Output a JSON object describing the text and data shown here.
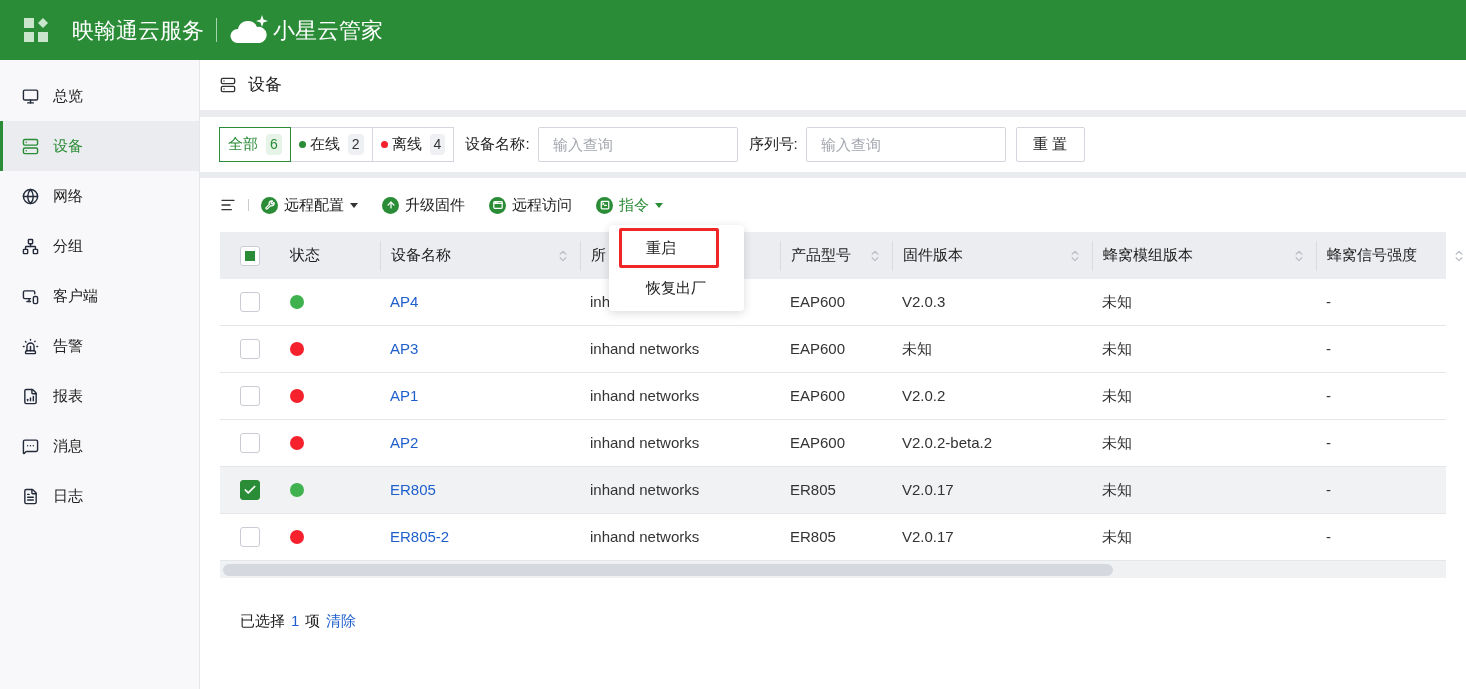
{
  "header": {
    "brand": "映翰通云服务",
    "product": "小星云管家"
  },
  "sidebar": {
    "items": [
      {
        "label": "总览",
        "selected": false
      },
      {
        "label": "设备",
        "selected": true
      },
      {
        "label": "网络",
        "selected": false
      },
      {
        "label": "分组",
        "selected": false
      },
      {
        "label": "客户端",
        "selected": false
      },
      {
        "label": "告警",
        "selected": false
      },
      {
        "label": "报表",
        "selected": false
      },
      {
        "label": "消息",
        "selected": false
      },
      {
        "label": "日志",
        "selected": false
      }
    ]
  },
  "page_title": "设备",
  "filter": {
    "tabs": [
      {
        "label": "全部",
        "count": "6",
        "selected": true
      },
      {
        "label": "在线",
        "count": "2",
        "selected": false,
        "color": "#2a8c37"
      },
      {
        "label": "离线",
        "count": "4",
        "selected": false,
        "color": "#f5222d"
      }
    ],
    "fields": [
      {
        "label": "设备名称:",
        "placeholder": "输入查询"
      },
      {
        "label": "序列号:",
        "placeholder": "输入查询"
      }
    ],
    "reset_button": "重 置"
  },
  "toolbar": {
    "actions": [
      {
        "label": "远程配置",
        "kind": "dropdown",
        "expanded": false
      },
      {
        "label": "升级固件",
        "kind": "button"
      },
      {
        "label": "远程访问",
        "kind": "button"
      },
      {
        "label": "指令",
        "kind": "dropdown",
        "expanded": true
      }
    ]
  },
  "menu": {
    "items": [
      {
        "label": "重启",
        "highlighted": true
      },
      {
        "label": "恢复出厂",
        "highlighted": false
      }
    ]
  },
  "table": {
    "select_all_indeterminate": true,
    "columns": [
      {
        "label": "状态",
        "sortable": false
      },
      {
        "label": "设备名称",
        "sortable": true
      },
      {
        "label": "所",
        "sortable": false
      },
      {
        "label": "产品型号",
        "sortable": true
      },
      {
        "label": "固件版本",
        "sortable": true
      },
      {
        "label": "蜂窝模组版本",
        "sortable": true
      },
      {
        "label": "蜂窝信号强度",
        "sortable": true
      }
    ],
    "rows": [
      {
        "checked": false,
        "selected": false,
        "color": "#3fb24f",
        "name": "AP4",
        "org": "inh",
        "model": "EAP600",
        "firmware": "V2.0.3",
        "module": "未知",
        "signal": "-"
      },
      {
        "checked": false,
        "selected": false,
        "color": "#f5222d",
        "name": "AP3",
        "org": "inhand networks",
        "model": "EAP600",
        "firmware": "未知",
        "module": "未知",
        "signal": "-"
      },
      {
        "checked": false,
        "selected": false,
        "color": "#f5222d",
        "name": "AP1",
        "org": "inhand networks",
        "model": "EAP600",
        "firmware": "V2.0.2",
        "module": "未知",
        "signal": "-"
      },
      {
        "checked": false,
        "selected": false,
        "color": "#f5222d",
        "name": "AP2",
        "org": "inhand networks",
        "model": "EAP600",
        "firmware": "V2.0.2-beta.2",
        "module": "未知",
        "signal": "-"
      },
      {
        "checked": true,
        "selected": true,
        "color": "#3fb24f",
        "name": "ER805",
        "org": "inhand networks",
        "model": "ER805",
        "firmware": "V2.0.17",
        "module": "未知",
        "signal": "-"
      },
      {
        "checked": false,
        "selected": false,
        "color": "#f5222d",
        "name": "ER805-2",
        "org": "inhand networks",
        "model": "ER805",
        "firmware": "V2.0.17",
        "module": "未知",
        "signal": "-"
      }
    ]
  },
  "footer": {
    "prefix": "已选择",
    "count": "1",
    "suffix": "项",
    "clear_link": "清除"
  }
}
